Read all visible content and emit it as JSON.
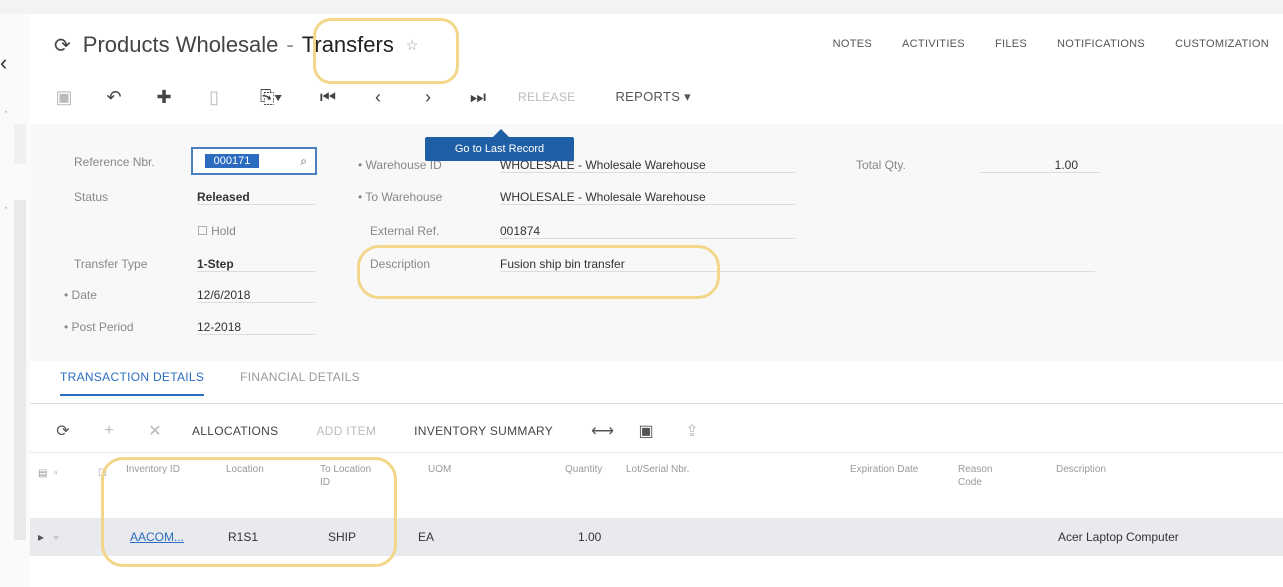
{
  "header": {
    "module": "Products Wholesale",
    "separator": "-",
    "screen": "Transfers",
    "links": [
      "NOTES",
      "ACTIVITIES",
      "FILES",
      "NOTIFICATIONS",
      "CUSTOMIZATION"
    ]
  },
  "toolbar": {
    "release_label": "RELEASE",
    "reports_label": "REPORTS ▾",
    "tooltip": "Go to Last Record"
  },
  "form": {
    "reference_label": "Reference Nbr.",
    "reference_value": "000171",
    "status_label": "Status",
    "status_value": "Released",
    "hold_label": "Hold",
    "transfer_type_label": "Transfer Type",
    "transfer_type_value": "1-Step",
    "date_label": "• Date",
    "date_value": "12/6/2018",
    "post_period_label": "• Post Period",
    "post_period_value": "12-2018",
    "warehouse_label": "• Warehouse ID",
    "warehouse_value": "WHOLESALE - Wholesale Warehouse",
    "to_warehouse_label": "• To Warehouse",
    "to_warehouse_value": "WHOLESALE - Wholesale Warehouse",
    "external_ref_label": "External Ref.",
    "external_ref_value": "001874",
    "description_label": "Description",
    "description_value": "Fusion ship bin transfer",
    "total_qty_label": "Total Qty.",
    "total_qty_value": "1.00"
  },
  "tabs": [
    "TRANSACTION DETAILS",
    "FINANCIAL DETAILS"
  ],
  "grid_toolbar": {
    "allocations": "ALLOCATIONS",
    "add_item": "ADD ITEM",
    "inventory_summary": "INVENTORY SUMMARY"
  },
  "grid": {
    "headers": {
      "inventory_id": "Inventory ID",
      "location": "Location",
      "to_location": "To Location ID",
      "uom": "UOM",
      "quantity": "Quantity",
      "lot_serial": "Lot/Serial Nbr.",
      "expiration": "Expiration Date",
      "reason": "Reason Code",
      "description": "Description"
    },
    "rows": [
      {
        "inventory_id": "AACOM...",
        "location": "R1S1",
        "to_location": "SHIP",
        "uom": "EA",
        "quantity": "1.00",
        "description": "Acer Laptop Computer"
      }
    ]
  }
}
